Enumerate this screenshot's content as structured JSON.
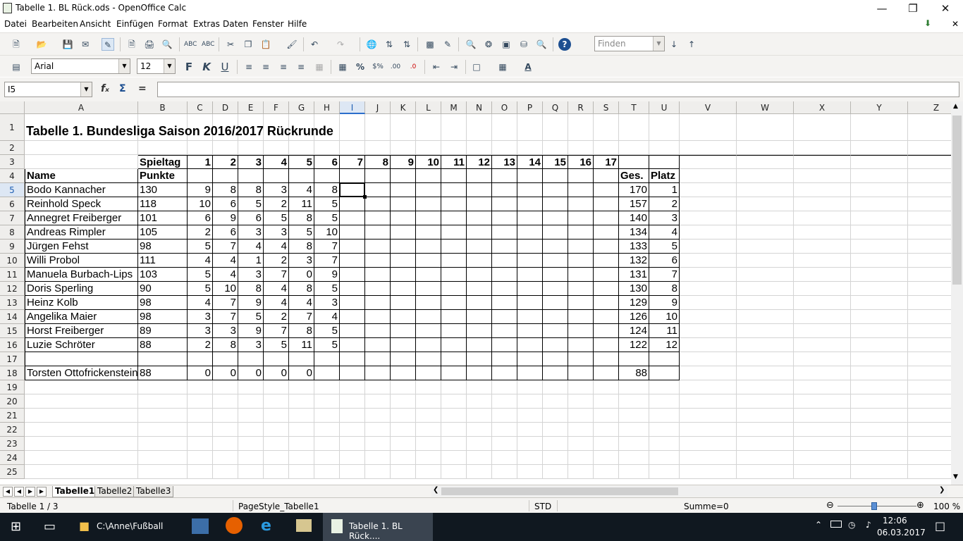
{
  "window": {
    "title": "Tabelle 1. BL Rück.ods - OpenOffice Calc"
  },
  "menu": [
    "Datei",
    "Bearbeiten",
    "Ansicht",
    "Einfügen",
    "Format",
    "Extras",
    "Daten",
    "Fenster",
    "Hilfe"
  ],
  "toolbar": {
    "find_placeholder": "Finden",
    "font_name": "Arial",
    "font_size": "12"
  },
  "formula": {
    "cell_ref": "I5",
    "content": ""
  },
  "columns": [
    "A",
    "B",
    "C",
    "D",
    "E",
    "F",
    "G",
    "H",
    "I",
    "J",
    "K",
    "L",
    "M",
    "N",
    "O",
    "P",
    "Q",
    "R",
    "S",
    "T",
    "U",
    "V",
    "W",
    "X",
    "Y",
    "Z"
  ],
  "rows": [
    "1",
    "2",
    "3",
    "4",
    "5",
    "6",
    "7",
    "8",
    "9",
    "10",
    "11",
    "12",
    "13",
    "14",
    "15",
    "16",
    "17",
    "18",
    "19",
    "20",
    "21",
    "22",
    "23",
    "24",
    "25"
  ],
  "sheet": {
    "title": "Tabelle 1. Bundesliga Saison 2016/2017 Rückrunde",
    "header_spieltag": "Spieltag",
    "matchdays": [
      "1",
      "2",
      "3",
      "4",
      "5",
      "6",
      "7",
      "8",
      "9",
      "10",
      "11",
      "12",
      "13",
      "14",
      "15",
      "16",
      "17"
    ],
    "header_name": "Name",
    "header_punkte": "Punkte",
    "header_ges": "Ges.",
    "header_platz": "Platz",
    "players": [
      {
        "name": "Bodo Kannacher",
        "punkte": "130",
        "scores": [
          "9",
          "8",
          "8",
          "3",
          "4",
          "8"
        ],
        "ges": "170",
        "platz": "1"
      },
      {
        "name": "Reinhold Speck",
        "punkte": "118",
        "scores": [
          "10",
          "6",
          "5",
          "2",
          "11",
          "5"
        ],
        "ges": "157",
        "platz": "2"
      },
      {
        "name": "Annegret Freiberger",
        "punkte": "101",
        "scores": [
          "6",
          "9",
          "6",
          "5",
          "8",
          "5"
        ],
        "ges": "140",
        "platz": "3"
      },
      {
        "name": "Andreas Rimpler",
        "punkte": "105",
        "scores": [
          "2",
          "6",
          "3",
          "3",
          "5",
          "10"
        ],
        "ges": "134",
        "platz": "4"
      },
      {
        "name": "Jürgen Fehst",
        "punkte": "98",
        "scores": [
          "5",
          "7",
          "4",
          "4",
          "8",
          "7"
        ],
        "ges": "133",
        "platz": "5"
      },
      {
        "name": "Willi Probol",
        "punkte": "111",
        "scores": [
          "4",
          "4",
          "1",
          "2",
          "3",
          "7"
        ],
        "ges": "132",
        "platz": "6"
      },
      {
        "name": "Manuela Burbach-Lips",
        "punkte": "103",
        "scores": [
          "5",
          "4",
          "3",
          "7",
          "0",
          "9"
        ],
        "ges": "131",
        "platz": "7"
      },
      {
        "name": "Doris Sperling",
        "punkte": "90",
        "scores": [
          "5",
          "10",
          "8",
          "4",
          "8",
          "5"
        ],
        "ges": "130",
        "platz": "8"
      },
      {
        "name": "Heinz Kolb",
        "punkte": "98",
        "scores": [
          "4",
          "7",
          "9",
          "4",
          "4",
          "3"
        ],
        "ges": "129",
        "platz": "9"
      },
      {
        "name": "Angelika Maier",
        "punkte": "98",
        "scores": [
          "3",
          "7",
          "5",
          "2",
          "7",
          "4"
        ],
        "ges": "126",
        "platz": "10"
      },
      {
        "name": "Horst Freiberger",
        "punkte": "89",
        "scores": [
          "3",
          "3",
          "9",
          "7",
          "8",
          "5"
        ],
        "ges": "124",
        "platz": "11"
      },
      {
        "name": "Luzie Schröter",
        "punkte": "88",
        "scores": [
          "2",
          "8",
          "3",
          "5",
          "11",
          "5"
        ],
        "ges": "122",
        "platz": "12"
      }
    ],
    "extra": {
      "name": "Torsten Ottofrickenstein",
      "punkte": "88",
      "scores": [
        "0",
        "0",
        "0",
        "0",
        "0",
        ""
      ],
      "ges": "88",
      "platz": ""
    }
  },
  "tabs": [
    "Tabelle1",
    "Tabelle2",
    "Tabelle3"
  ],
  "status": {
    "sheet": "Tabelle 1 / 3",
    "pagestyle": "PageStyle_Tabelle1",
    "mode": "STD",
    "sum": "Summe=0",
    "zoom": "100 %"
  },
  "taskbar": {
    "explorer_label": "C:\\Anne\\Fußball",
    "calc_label": "Tabelle 1. BL Rück....",
    "time": "12:06",
    "date": "06.03.2017"
  }
}
